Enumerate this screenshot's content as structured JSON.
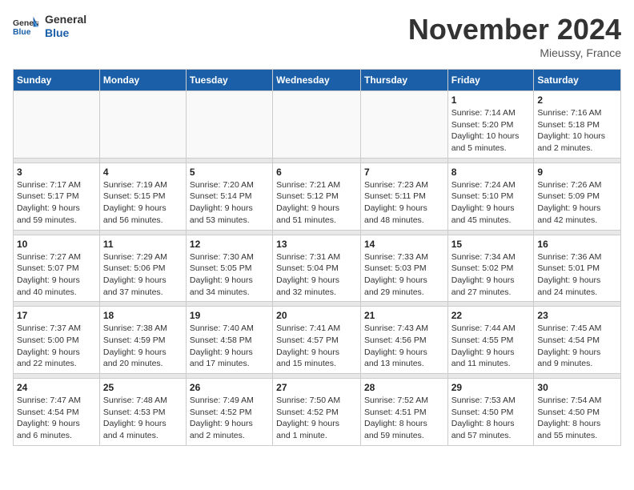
{
  "header": {
    "logo_general": "General",
    "logo_blue": "Blue",
    "month_title": "November 2024",
    "location": "Mieussy, France"
  },
  "weekdays": [
    "Sunday",
    "Monday",
    "Tuesday",
    "Wednesday",
    "Thursday",
    "Friday",
    "Saturday"
  ],
  "weeks": [
    [
      {
        "day": "",
        "info": ""
      },
      {
        "day": "",
        "info": ""
      },
      {
        "day": "",
        "info": ""
      },
      {
        "day": "",
        "info": ""
      },
      {
        "day": "",
        "info": ""
      },
      {
        "day": "1",
        "info": "Sunrise: 7:14 AM\nSunset: 5:20 PM\nDaylight: 10 hours\nand 5 minutes."
      },
      {
        "day": "2",
        "info": "Sunrise: 7:16 AM\nSunset: 5:18 PM\nDaylight: 10 hours\nand 2 minutes."
      }
    ],
    [
      {
        "day": "3",
        "info": "Sunrise: 7:17 AM\nSunset: 5:17 PM\nDaylight: 9 hours\nand 59 minutes."
      },
      {
        "day": "4",
        "info": "Sunrise: 7:19 AM\nSunset: 5:15 PM\nDaylight: 9 hours\nand 56 minutes."
      },
      {
        "day": "5",
        "info": "Sunrise: 7:20 AM\nSunset: 5:14 PM\nDaylight: 9 hours\nand 53 minutes."
      },
      {
        "day": "6",
        "info": "Sunrise: 7:21 AM\nSunset: 5:12 PM\nDaylight: 9 hours\nand 51 minutes."
      },
      {
        "day": "7",
        "info": "Sunrise: 7:23 AM\nSunset: 5:11 PM\nDaylight: 9 hours\nand 48 minutes."
      },
      {
        "day": "8",
        "info": "Sunrise: 7:24 AM\nSunset: 5:10 PM\nDaylight: 9 hours\nand 45 minutes."
      },
      {
        "day": "9",
        "info": "Sunrise: 7:26 AM\nSunset: 5:09 PM\nDaylight: 9 hours\nand 42 minutes."
      }
    ],
    [
      {
        "day": "10",
        "info": "Sunrise: 7:27 AM\nSunset: 5:07 PM\nDaylight: 9 hours\nand 40 minutes."
      },
      {
        "day": "11",
        "info": "Sunrise: 7:29 AM\nSunset: 5:06 PM\nDaylight: 9 hours\nand 37 minutes."
      },
      {
        "day": "12",
        "info": "Sunrise: 7:30 AM\nSunset: 5:05 PM\nDaylight: 9 hours\nand 34 minutes."
      },
      {
        "day": "13",
        "info": "Sunrise: 7:31 AM\nSunset: 5:04 PM\nDaylight: 9 hours\nand 32 minutes."
      },
      {
        "day": "14",
        "info": "Sunrise: 7:33 AM\nSunset: 5:03 PM\nDaylight: 9 hours\nand 29 minutes."
      },
      {
        "day": "15",
        "info": "Sunrise: 7:34 AM\nSunset: 5:02 PM\nDaylight: 9 hours\nand 27 minutes."
      },
      {
        "day": "16",
        "info": "Sunrise: 7:36 AM\nSunset: 5:01 PM\nDaylight: 9 hours\nand 24 minutes."
      }
    ],
    [
      {
        "day": "17",
        "info": "Sunrise: 7:37 AM\nSunset: 5:00 PM\nDaylight: 9 hours\nand 22 minutes."
      },
      {
        "day": "18",
        "info": "Sunrise: 7:38 AM\nSunset: 4:59 PM\nDaylight: 9 hours\nand 20 minutes."
      },
      {
        "day": "19",
        "info": "Sunrise: 7:40 AM\nSunset: 4:58 PM\nDaylight: 9 hours\nand 17 minutes."
      },
      {
        "day": "20",
        "info": "Sunrise: 7:41 AM\nSunset: 4:57 PM\nDaylight: 9 hours\nand 15 minutes."
      },
      {
        "day": "21",
        "info": "Sunrise: 7:43 AM\nSunset: 4:56 PM\nDaylight: 9 hours\nand 13 minutes."
      },
      {
        "day": "22",
        "info": "Sunrise: 7:44 AM\nSunset: 4:55 PM\nDaylight: 9 hours\nand 11 minutes."
      },
      {
        "day": "23",
        "info": "Sunrise: 7:45 AM\nSunset: 4:54 PM\nDaylight: 9 hours\nand 9 minutes."
      }
    ],
    [
      {
        "day": "24",
        "info": "Sunrise: 7:47 AM\nSunset: 4:54 PM\nDaylight: 9 hours\nand 6 minutes."
      },
      {
        "day": "25",
        "info": "Sunrise: 7:48 AM\nSunset: 4:53 PM\nDaylight: 9 hours\nand 4 minutes."
      },
      {
        "day": "26",
        "info": "Sunrise: 7:49 AM\nSunset: 4:52 PM\nDaylight: 9 hours\nand 2 minutes."
      },
      {
        "day": "27",
        "info": "Sunrise: 7:50 AM\nSunset: 4:52 PM\nDaylight: 9 hours\nand 1 minute."
      },
      {
        "day": "28",
        "info": "Sunrise: 7:52 AM\nSunset: 4:51 PM\nDaylight: 8 hours\nand 59 minutes."
      },
      {
        "day": "29",
        "info": "Sunrise: 7:53 AM\nSunset: 4:50 PM\nDaylight: 8 hours\nand 57 minutes."
      },
      {
        "day": "30",
        "info": "Sunrise: 7:54 AM\nSunset: 4:50 PM\nDaylight: 8 hours\nand 55 minutes."
      }
    ]
  ]
}
